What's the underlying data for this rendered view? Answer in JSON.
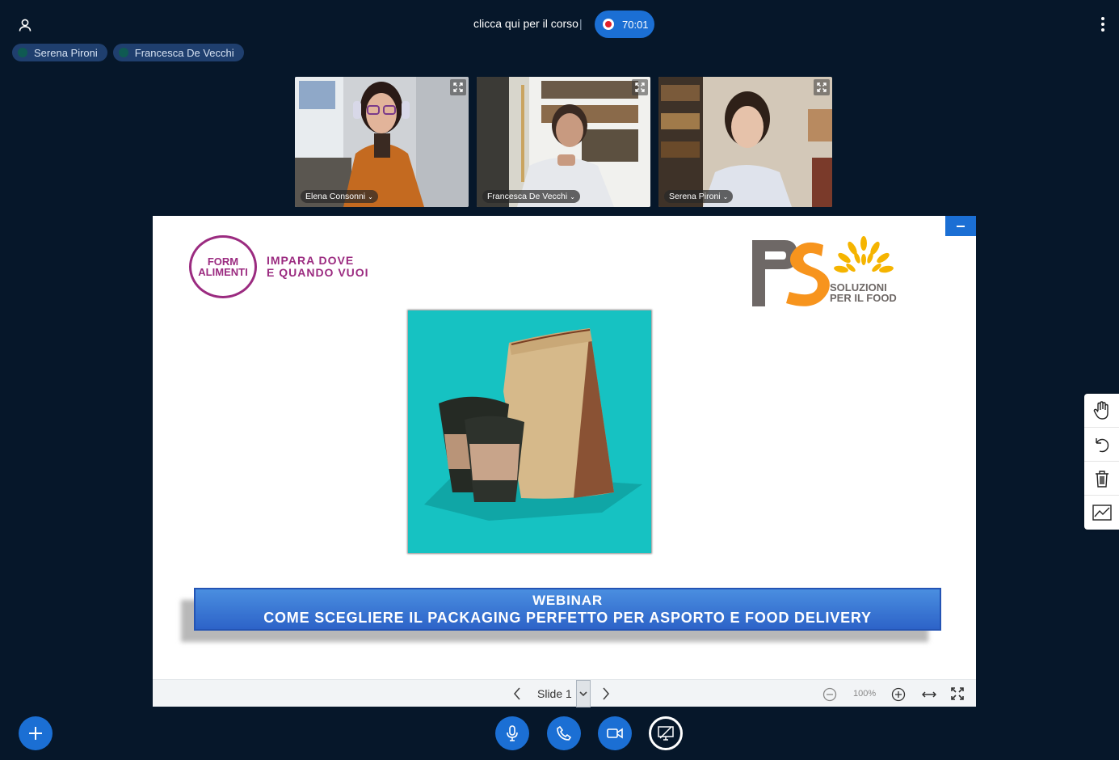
{
  "header": {
    "course_link": "clicca qui per il corso",
    "separator": "|",
    "recording_time": "70:01"
  },
  "talkers": [
    {
      "name": "Serena Pironi"
    },
    {
      "name": "Francesca De Vecchi"
    }
  ],
  "videos": [
    {
      "name": "Elena Consonni"
    },
    {
      "name": "Francesca De Vecchi"
    },
    {
      "name": "Serena Pironi"
    }
  ],
  "slide": {
    "logo_left": {
      "line1": "FORM",
      "line2": "ALIMENTI",
      "tag1": "IMPARA DOVE",
      "tag2": "E QUANDO VUOI"
    },
    "logo_right": {
      "line1": "SOLUZIONI",
      "line2": "PER IL FOOD"
    },
    "banner": {
      "line1": "WEBINAR",
      "line2": "COME SCEGLIERE IL PACKAGING PERFETTO PER ASPORTO E FOOD DELIVERY"
    }
  },
  "presentation_toolbar": {
    "slide_label": "Slide 1",
    "zoom": "100%"
  },
  "icons": {
    "user": "user-icon",
    "options": "kebab-icon",
    "pan": "hand-icon",
    "undo": "undo-icon",
    "clear": "trash-icon",
    "multi_user": "chart-icon",
    "add": "plus-icon",
    "mic": "microphone-icon",
    "phone": "phone-icon",
    "camera": "camera-icon",
    "share": "screen-share-icon"
  },
  "colors": {
    "background": "#06172a",
    "accent": "#1b6fd4",
    "brand_purple": "#9b2b80",
    "brand_orange": "#f7941d"
  }
}
